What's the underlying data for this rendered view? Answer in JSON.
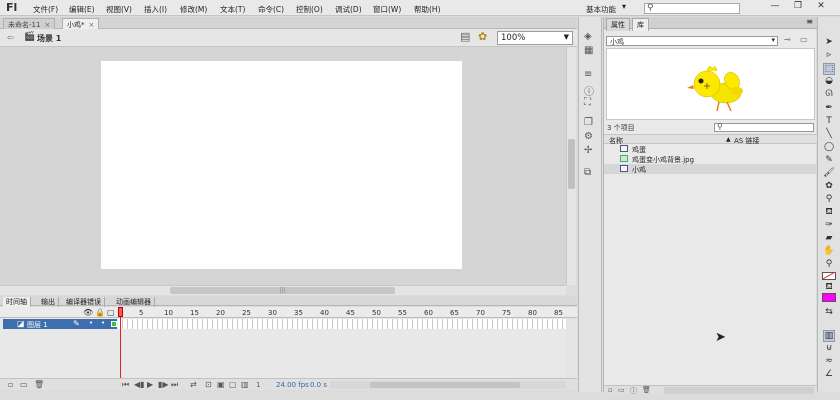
{
  "app": {
    "logo": "Fl",
    "menus": [
      "文件(F)",
      "编辑(E)",
      "视图(V)",
      "插入(I)",
      "修改(M)",
      "文本(T)",
      "命令(C)",
      "控制(O)",
      "调试(D)",
      "窗口(W)",
      "帮助(H)"
    ],
    "workspace": "基本功能",
    "window_buttons": [
      "—",
      "❐",
      "✕"
    ]
  },
  "doc_tabs": [
    {
      "label": "未命名-11",
      "close": "×"
    },
    {
      "label": "小鸡*",
      "close": "×"
    }
  ],
  "scene": {
    "label": "场景 1",
    "zoom": "100%"
  },
  "timeline": {
    "tabs": [
      "时间轴",
      "输出",
      "编译器错误",
      "动画编辑器"
    ],
    "ruler": [
      "1",
      "5",
      "10",
      "15",
      "20",
      "25",
      "30",
      "35",
      "40",
      "45",
      "50",
      "55",
      "60",
      "65",
      "70",
      "75",
      "80",
      "85"
    ],
    "layer_name": "图层 1",
    "current_frame": "1",
    "fps": "24.00 fps",
    "elapsed": "0.0 s"
  },
  "library": {
    "tabs": [
      "属性",
      "库"
    ],
    "selected_doc": "小鸡",
    "item_count": "3 个项目",
    "columns": {
      "name": "名称",
      "link": "AS 链接",
      "sort": "▲"
    },
    "items": [
      {
        "label": "鸡蛋",
        "type": "symbol"
      },
      {
        "label": "鸡蛋变小鸡背景.jpg",
        "type": "image"
      },
      {
        "label": "小鸡",
        "type": "symbol",
        "selected": true
      }
    ]
  },
  "colors": {
    "stage_bg": "#ffffff",
    "layer_highlight": "#3d6fae",
    "fill_color": "#ff00ff",
    "playhead": "#dd2222"
  }
}
